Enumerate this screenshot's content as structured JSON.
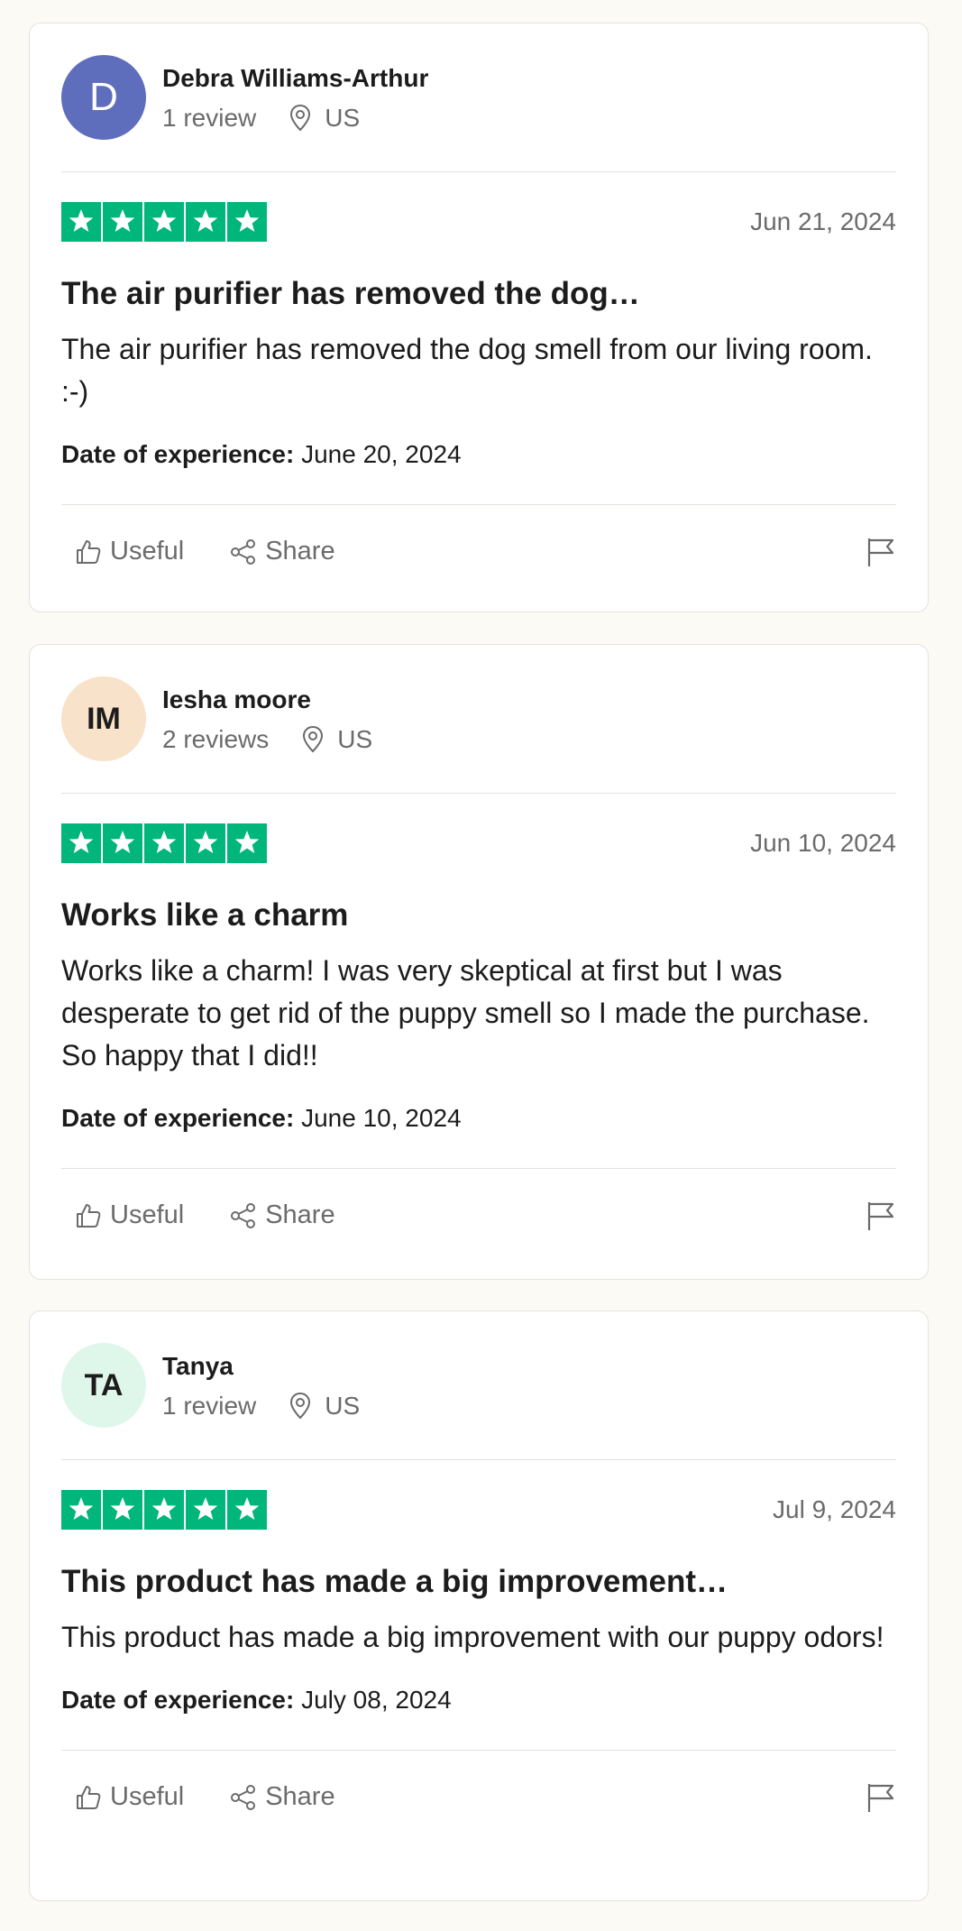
{
  "colors": {
    "star_green": "#00b67a",
    "page_bg": "#fbfaf4"
  },
  "reviews": [
    {
      "avatar": {
        "text": "D",
        "bg": "#5f6dbd",
        "fg": "#ffffff",
        "style": "letter"
      },
      "name": "Debra Williams-Arthur",
      "review_count": "1 review",
      "location": "US",
      "stars": 5,
      "date": "Jun 21, 2024",
      "title": "The air purifier has removed the dog…",
      "body": "The air purifier has removed the dog smell from our living room. :-)",
      "experience_label": "Date of experience:",
      "experience_date": "June 20, 2024",
      "useful_label": "Useful",
      "share_label": "Share"
    },
    {
      "avatar": {
        "text": "IM",
        "bg": "#f8e2c9",
        "fg": "#1c1c1c",
        "style": "initials"
      },
      "name": "Iesha moore",
      "review_count": "2 reviews",
      "location": "US",
      "stars": 5,
      "date": "Jun 10, 2024",
      "title": "Works like a charm",
      "body": "Works like a charm! I was very skeptical at first but I was desperate to get rid of the puppy smell so I made the purchase. So happy that I did!!",
      "experience_label": "Date of experience:",
      "experience_date": "June 10, 2024",
      "useful_label": "Useful",
      "share_label": "Share"
    },
    {
      "avatar": {
        "text": "TA",
        "bg": "#dff7ea",
        "fg": "#1c1c1c",
        "style": "initials"
      },
      "name": "Tanya",
      "review_count": "1 review",
      "location": "US",
      "stars": 5,
      "date": "Jul 9, 2024",
      "title": "This product has made a big improvement…",
      "body": "This product has made a big improvement with our puppy odors!",
      "experience_label": "Date of experience:",
      "experience_date": "July 08, 2024",
      "useful_label": "Useful",
      "share_label": "Share"
    }
  ]
}
